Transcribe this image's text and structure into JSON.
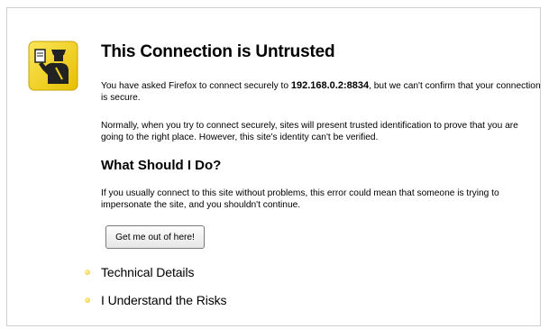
{
  "page": {
    "title": "This Connection is Untrusted",
    "intro_prefix": "You have asked Firefox to connect securely to ",
    "host": "192.168.0.2:8834",
    "intro_suffix": ", but we can't confirm that your connection is secure.",
    "normal_text": "Normally, when you try to connect securely, sites will present trusted identification to prove that you are going to the right place. However, this site's identity can't be verified.",
    "what_heading": "What Should I Do?",
    "advice_text": "If you usually connect to this site without problems, this error could mean that someone is trying to impersonate the site, and you shouldn't continue.",
    "escape_button": "Get me out of here!",
    "technical_details": "Technical Details",
    "understand_risks": "I Understand the Risks"
  },
  "icons": {
    "main": "officer-warning-icon",
    "bullet": "expander-bullet-icon"
  },
  "colors": {
    "icon_background": "#f2d21c",
    "bullet": "#f0c020",
    "frame_border": "#cfcfcf"
  }
}
